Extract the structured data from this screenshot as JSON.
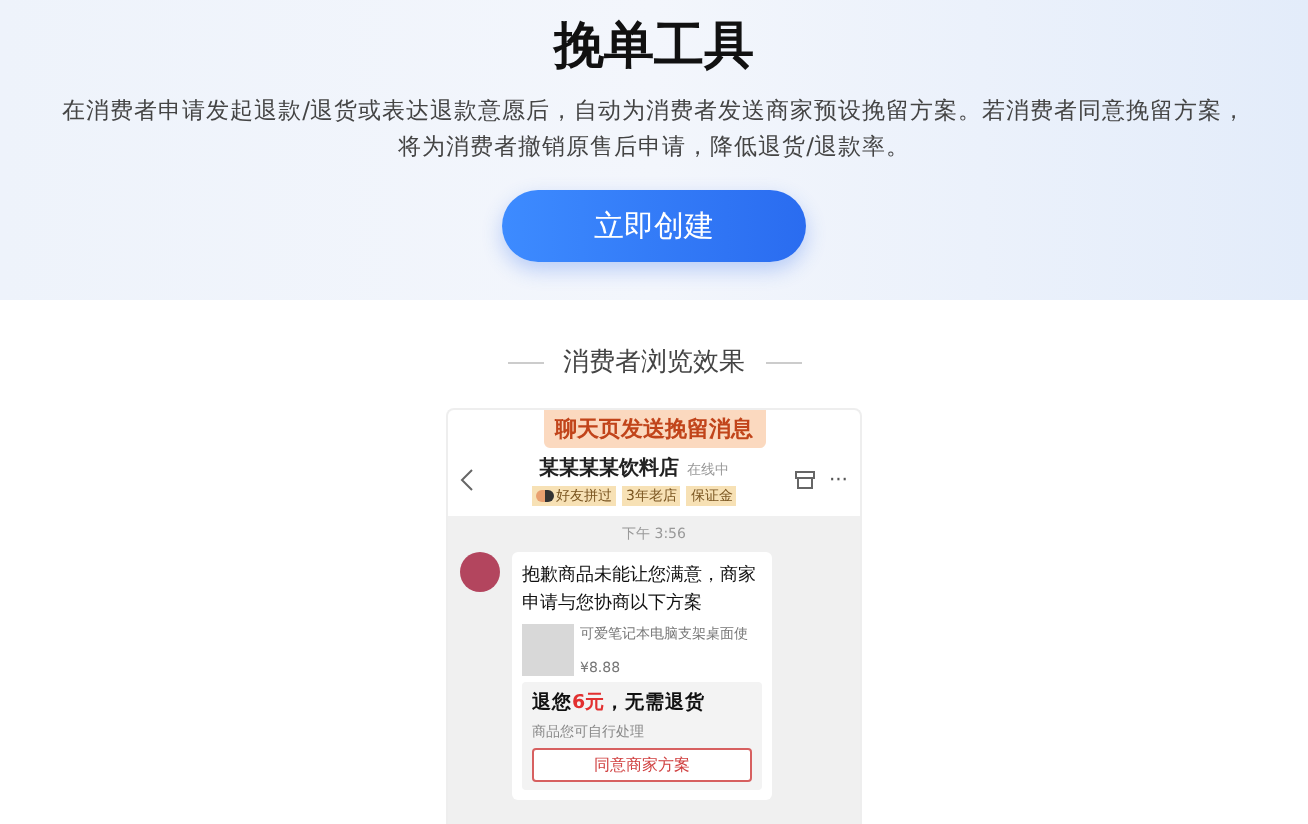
{
  "hero": {
    "title": "挽单工具",
    "description": [
      "在消费者申请发起退款/退货或表达退款意愿后，自动为消费者发送商家预设挽留方案。若消费者同意挽留方案，",
      "将为消费者撤销原售后申请，降低退货/退款率。"
    ],
    "button": "立即创建"
  },
  "preview": {
    "heading": "消费者浏览效果",
    "badge": "聊天页发送挽留消息",
    "chat_header": {
      "shop_name": "某某某某饮料店",
      "status": "在线中",
      "tags": [
        {
          "kind": "friends",
          "label": "好友拼过"
        },
        {
          "kind": "plain",
          "label": "3年老店"
        },
        {
          "kind": "plain",
          "label": "保证金"
        }
      ],
      "more": "···"
    },
    "time": "下午 3:56",
    "message": {
      "text": "抱歉商品未能让您满意，商家申请与您协商以下方案",
      "product_name": "可爱笔记本电脑支架桌面使",
      "price": "¥8.88",
      "offer_title": [
        {
          "text": "退您",
          "highlight": false
        },
        {
          "text": "6元",
          "highlight": true
        },
        {
          "text": "，无需退货",
          "highlight": false
        }
      ],
      "offer_note": "商品您可自行处理",
      "offer_button": "同意商家方案"
    }
  }
}
